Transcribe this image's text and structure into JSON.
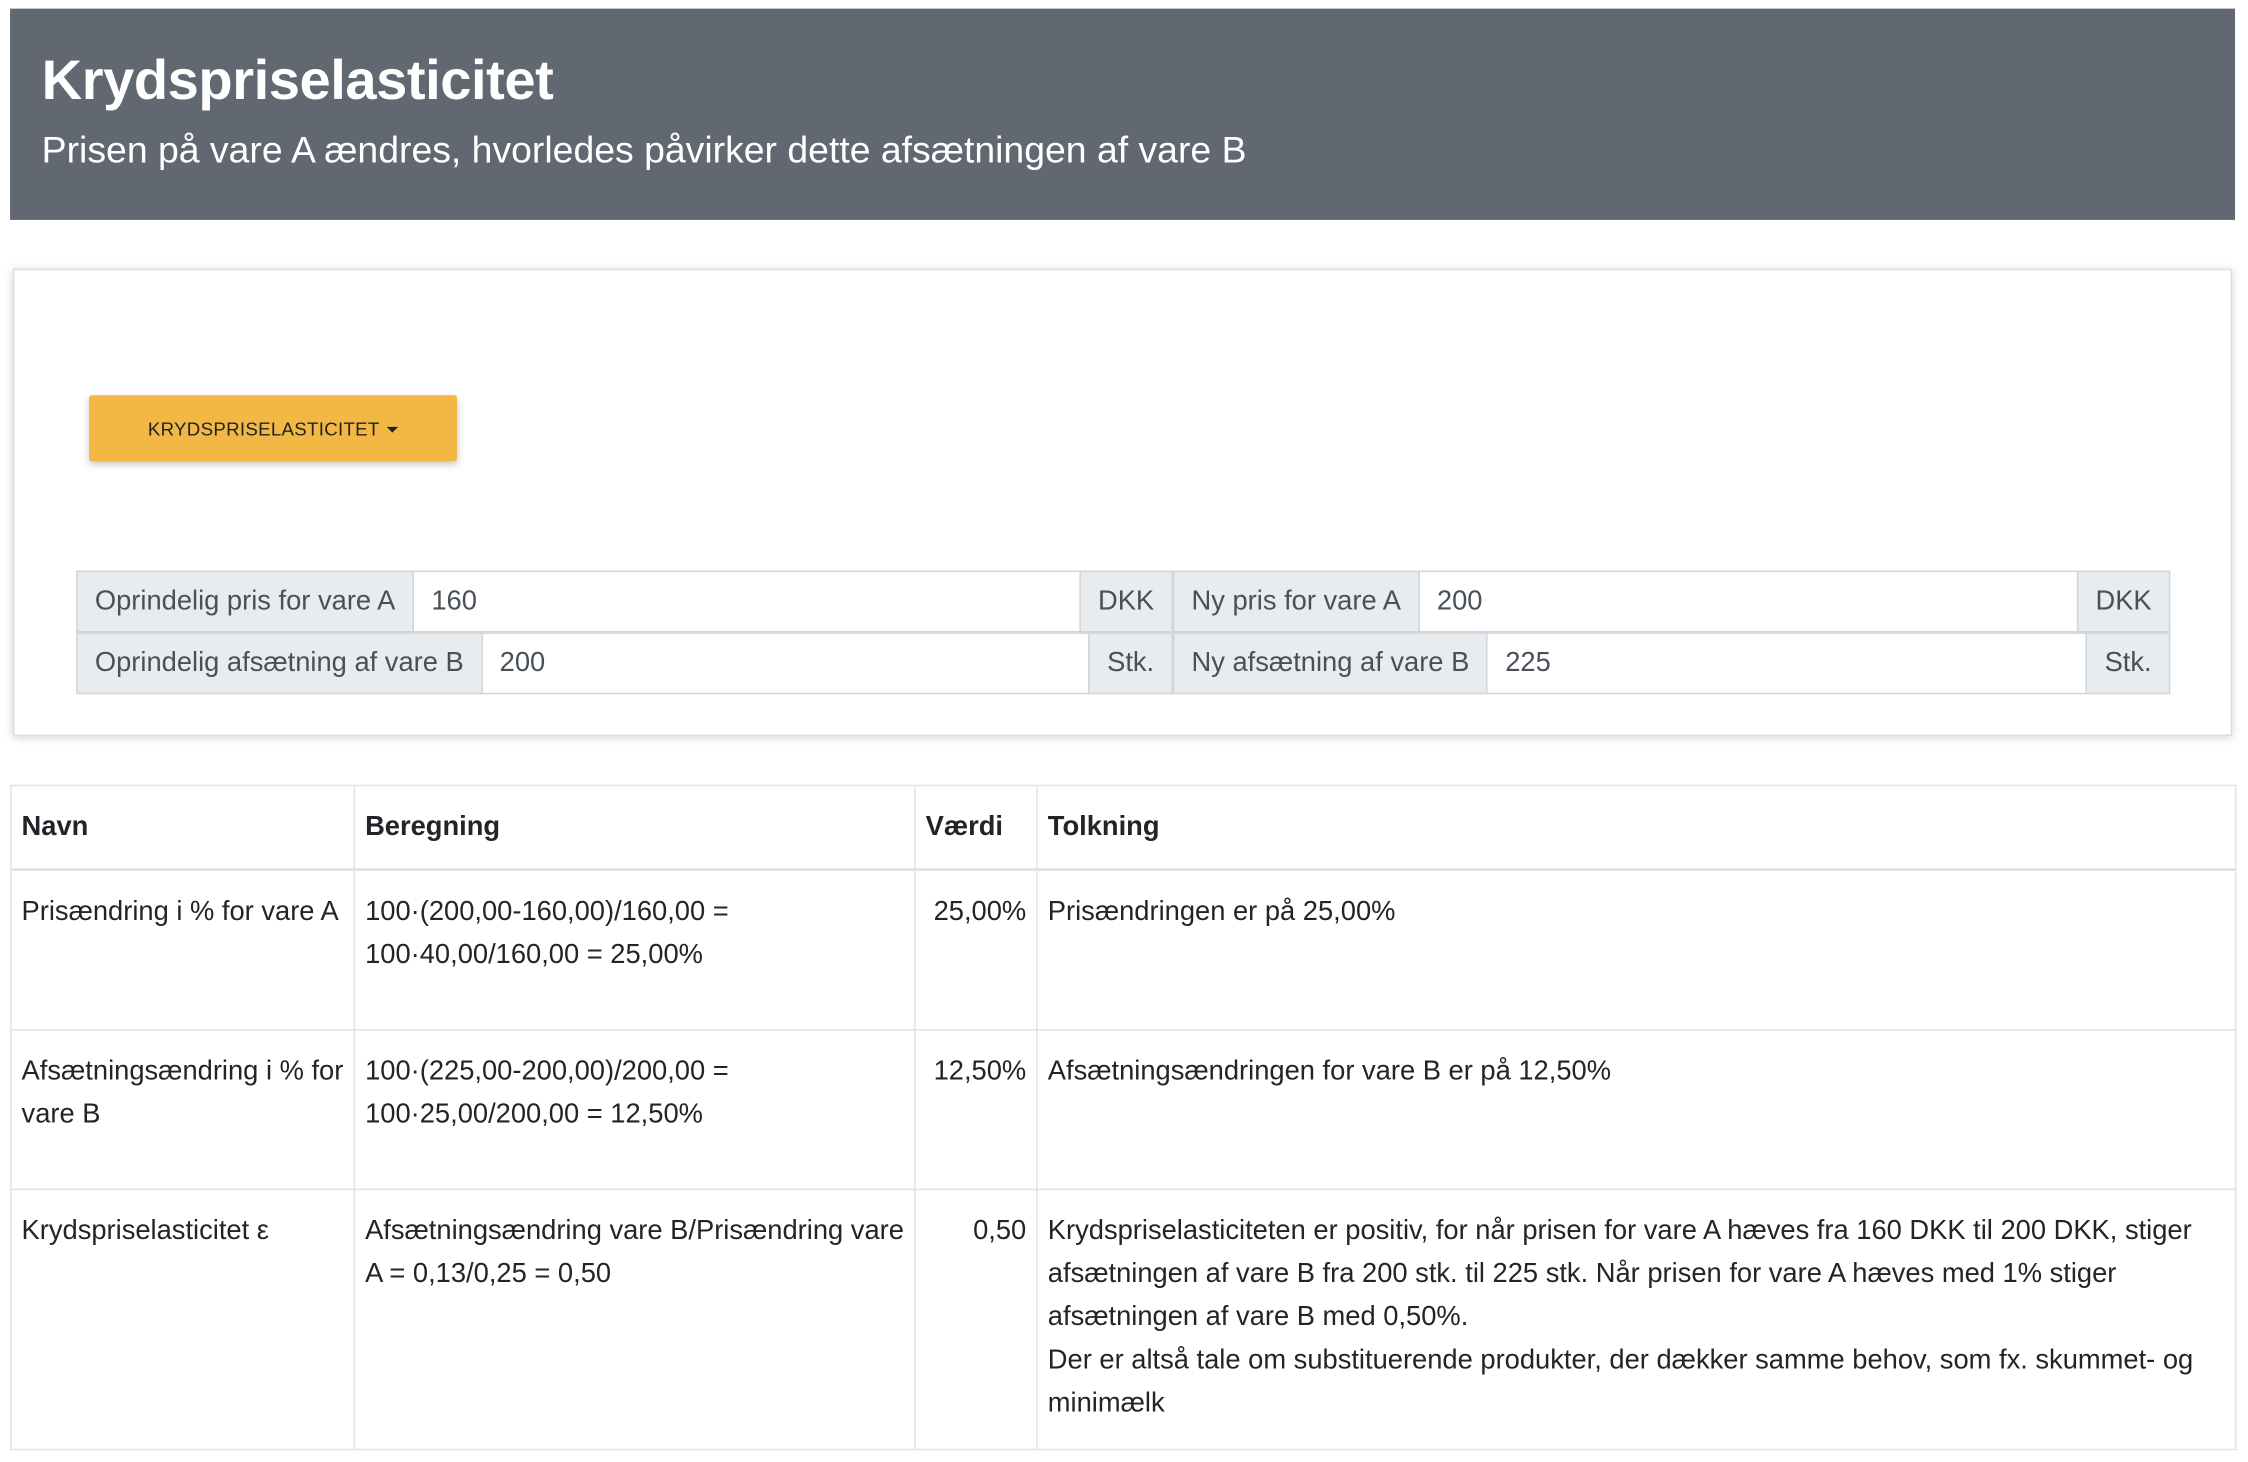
{
  "header": {
    "title": "Krydspriselasticitet",
    "subtitle": "Prisen på vare A ændres, hvorledes påvirker dette afsætningen af vare B"
  },
  "calculator": {
    "dropdown_label": "KRYDSPRISELASTICITET",
    "fields": {
      "orig_price_a": {
        "label": "Oprindelig pris for vare A",
        "value": "160",
        "unit": "DKK"
      },
      "new_price_a": {
        "label": "Ny pris for vare A",
        "value": "200",
        "unit": "DKK"
      },
      "orig_sales_b": {
        "label": "Oprindelig afsætning af vare B",
        "value": "200",
        "unit": "Stk."
      },
      "new_sales_b": {
        "label": "Ny afsætning af vare B",
        "value": "225",
        "unit": "Stk."
      }
    }
  },
  "results": {
    "columns": [
      "Navn",
      "Beregning",
      "Værdi",
      "Tolkning"
    ],
    "rows": [
      {
        "navn": "Prisændring i % for vare A",
        "beregning": [
          "100·(200,00-160,00)/160,00 =",
          "100·40,00/160,00 = 25,00%"
        ],
        "vaerdi": "25,00%",
        "tolkning": [
          "Prisændringen er på 25,00%"
        ]
      },
      {
        "navn": "Afsætningsændring i % for vare B",
        "beregning": [
          "100·(225,00-200,00)/200,00 =",
          "100·25,00/200,00 = 12,50%"
        ],
        "vaerdi": "12,50%",
        "tolkning": [
          "Afsætningsændringen for vare B er på 12,50%"
        ]
      },
      {
        "navn": "Krydspriselasticitet ε",
        "beregning": [
          "Afsætningsændring vare B/Prisændring vare A = 0,13/0,25 = 0,50"
        ],
        "vaerdi": "0,50",
        "tolkning": [
          "Krydspriselasticiteten er positiv, for når prisen for vare A hæves fra 160 DKK til 200 DKK, stiger afsætningen af vare B fra 200 stk. til 225 stk. Når prisen for vare A hæves med 1% stiger afsætningen af vare B med 0,50%.",
          "Der er altså tale om substituerende produkter, der dækker samme behov, som fx. skummet- og minimælk"
        ]
      }
    ]
  }
}
